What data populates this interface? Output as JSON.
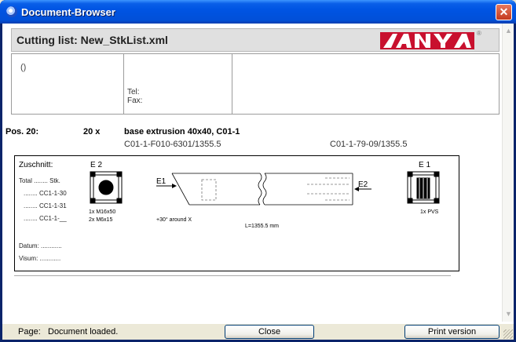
{
  "window": {
    "title": "Document-Browser",
    "close_glyph": "✕"
  },
  "header": {
    "title": "Cutting list: New_StkList.xml",
    "logo_text": "KANYA",
    "logo_reg": "®"
  },
  "info": {
    "address_placeholder": "()",
    "tel": "Tel:",
    "fax": "Fax:"
  },
  "position": {
    "label": "Pos. 20:",
    "quantity": "20 x",
    "description": "base extrusion 40x40, C01-1",
    "code_left": "C01-1-F010-6301/1355.5",
    "code_right": "C01-1-79-09/1355.5"
  },
  "drawing": {
    "heading": "Zuschnitt:",
    "totals": [
      "Total ........ Stk.",
      "........ CC1-1-30",
      "........ CC1-1-31",
      "........ CC1-1-__"
    ],
    "datum": "Datum: ............",
    "visum": "Visum: ............",
    "end_left_label": "E 2",
    "end_right_label": "E 1",
    "profile_left_notes": [
      "1x M16x50",
      "2x M6x15"
    ],
    "profile_right_note": "1x PVS",
    "arrow_left": "E1",
    "arrow_right": "E2",
    "rotation_note": "+30° around X",
    "length_note": "L=1355.5 mm"
  },
  "status": {
    "page_label": "Page:",
    "text": "Document loaded."
  },
  "buttons": {
    "close": "Close",
    "print": "Print version"
  },
  "icons": [
    "app-icon",
    "close-icon",
    "scroll-up-icon",
    "scroll-down-icon",
    "resize-grip-icon"
  ]
}
